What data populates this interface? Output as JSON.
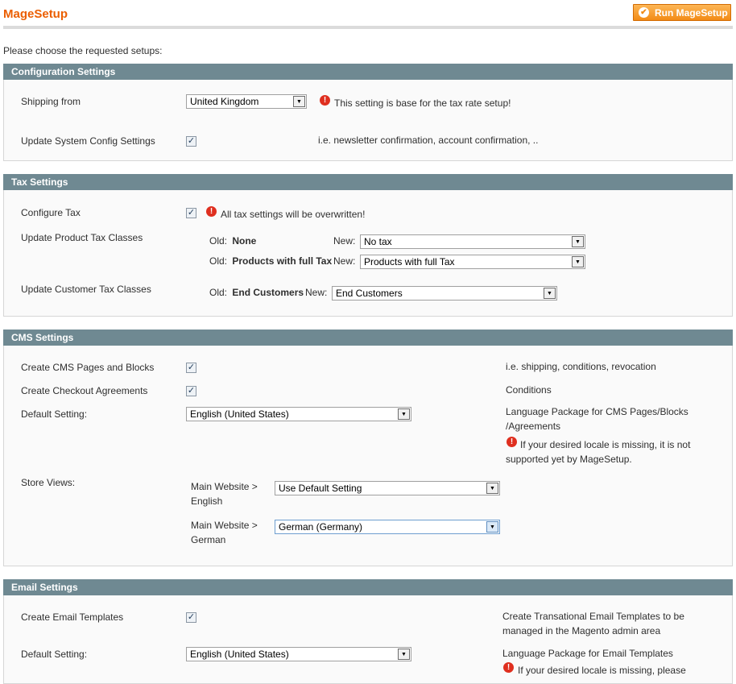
{
  "header": {
    "title": "MageSetup",
    "run_button": "Run MageSetup",
    "intro": "Please choose the requested setups:"
  },
  "config": {
    "title": "Configuration Settings",
    "shipping_label": "Shipping from",
    "shipping_value": "United Kingdom",
    "shipping_note": "This setting is base for the tax rate setup!",
    "update_label": "Update System Config Settings",
    "update_checked": true,
    "update_note": "i.e. newsletter confirmation, account confirmation, .."
  },
  "tax": {
    "title": "Tax Settings",
    "configure_label": "Configure Tax",
    "configure_note": "All tax settings will be overwritten!",
    "product_label": "Update Product Tax Classes",
    "old_label": "Old:",
    "new_label": "New:",
    "product_rows": [
      {
        "old": "None",
        "new": "No tax"
      },
      {
        "old": "Products with full Tax",
        "new": "Products with full Tax"
      }
    ],
    "customer_label": "Update Customer Tax Classes",
    "customer_old": "End Customers",
    "customer_new": "End Customers"
  },
  "cms": {
    "title": "CMS Settings",
    "pages_label": "Create CMS Pages and Blocks",
    "pages_note": "i.e. shipping, conditions, revocation",
    "agreements_label": "Create Checkout Agreements",
    "agreements_note": "Conditions",
    "default_label": "Default Setting:",
    "default_value": "English (United States)",
    "default_note": "Language Package for CMS Pages/Blocks /Agreements",
    "default_warn": "If your desired locale is missing, it is not supported yet by MageSetup.",
    "store_views_label": "Store Views:",
    "store_views": [
      {
        "label": "Main Website > English",
        "value": "Use Default Setting"
      },
      {
        "label": "Main Website > German",
        "value": "German (Germany)"
      }
    ]
  },
  "email": {
    "title": "Email Settings",
    "templates_label": "Create Email Templates",
    "templates_note": "Create Transational Email Templates to be managed in the Magento admin area",
    "default_label": "Default Setting:",
    "default_value": "English (United States)",
    "default_note": "Language Package for Email Templates",
    "default_warn": "If your desired locale is missing, please"
  }
}
